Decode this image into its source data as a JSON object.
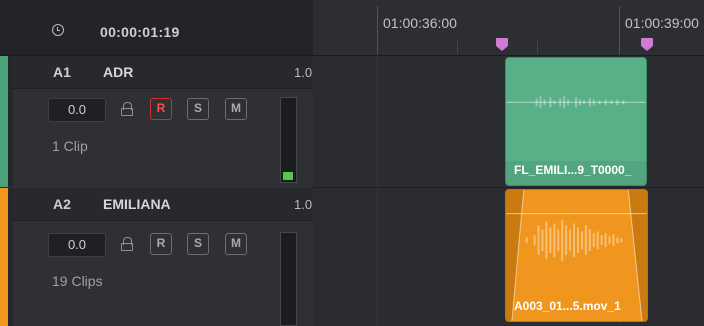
{
  "header": {
    "timecode": "00:00:01:19",
    "clock_icon": "clock-icon"
  },
  "ruler": {
    "labels": [
      "01:00:36:00",
      "01:00:39:00"
    ]
  },
  "tracks": [
    {
      "id": "A1",
      "name": "ADR",
      "level": "1.0",
      "volume": "0.0",
      "buttons": {
        "r": "R",
        "s": "S",
        "m": "M"
      },
      "clip_count": "1 Clip",
      "color": "#49a27a",
      "clip": {
        "name": "FL_EMILI...9_T0000_",
        "color": "#58b087"
      }
    },
    {
      "id": "A2",
      "name": "EMILIANA",
      "level": "1.0",
      "volume": "0.0",
      "buttons": {
        "r": "R",
        "s": "S",
        "m": "M"
      },
      "clip_count": "19 Clips",
      "color": "#f0951e",
      "clip": {
        "name": "A003_01...5.mov_1",
        "color": "#f0951e"
      }
    }
  ],
  "colors": {
    "record_active": "#d62b2b",
    "marker": "#d07ad6",
    "meter": "#55c84c"
  }
}
